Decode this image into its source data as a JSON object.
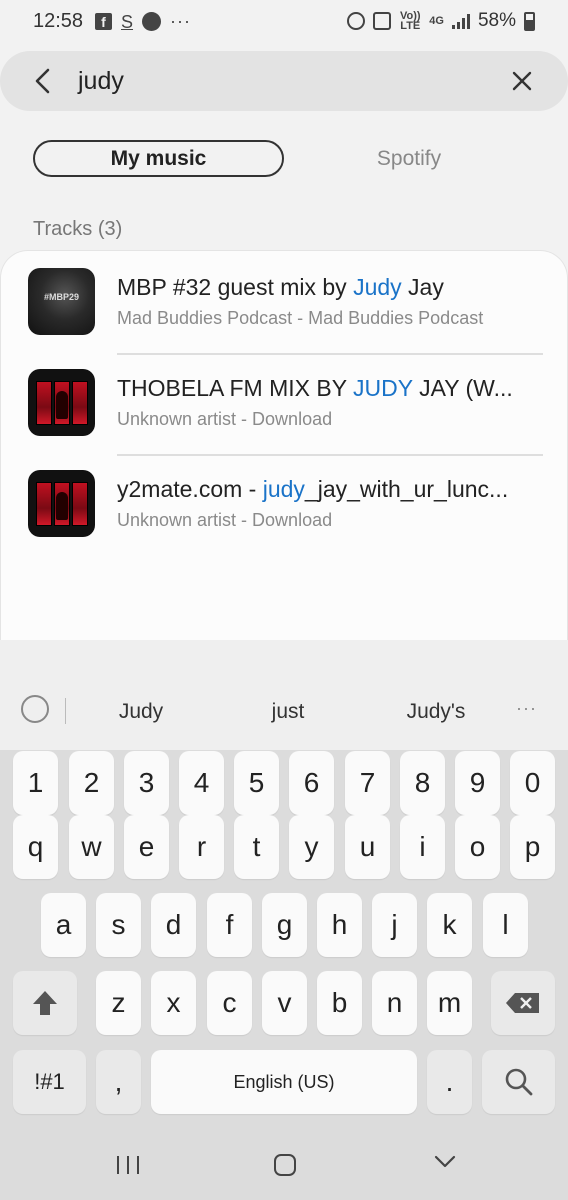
{
  "status": {
    "time": "12:58",
    "volte": "Vo)) LTE",
    "net": "4G",
    "battery": "58%"
  },
  "search": {
    "query": "judy"
  },
  "tabs": {
    "my_music": "My music",
    "spotify": "Spotify"
  },
  "section": {
    "title": "Tracks (3)"
  },
  "tracks": [
    {
      "title_before": "MBP #32 guest mix by ",
      "title_highlight": "Judy",
      "title_after": " Jay",
      "subtitle": "Mad Buddies Podcast - Mad Buddies Podcast",
      "thumb_label": "#MBP29"
    },
    {
      "title_before": "THOBELA FM MIX BY ",
      "title_highlight": "JUDY",
      "title_after": " JAY (W...",
      "subtitle": "Unknown artist - Download"
    },
    {
      "title_before": "y2mate.com - ",
      "title_highlight": "judy",
      "title_after": "_jay_with_ur_lunc...",
      "subtitle": "Unknown artist - Download"
    }
  ],
  "keyboard": {
    "suggestions": [
      "Judy",
      "just",
      "Judy's"
    ],
    "row_numbers": [
      "1",
      "2",
      "3",
      "4",
      "5",
      "6",
      "7",
      "8",
      "9",
      "0"
    ],
    "row_1": [
      "q",
      "w",
      "e",
      "r",
      "t",
      "y",
      "u",
      "i",
      "o",
      "p"
    ],
    "row_2": [
      "a",
      "s",
      "d",
      "f",
      "g",
      "h",
      "j",
      "k",
      "l"
    ],
    "row_3": [
      "z",
      "x",
      "c",
      "v",
      "b",
      "n",
      "m"
    ],
    "symbols": "!#1",
    "comma": ",",
    "space": "English (US)",
    "period": "."
  },
  "colors": {
    "highlight": "#1a73c8",
    "background": "#f2f2f2"
  }
}
